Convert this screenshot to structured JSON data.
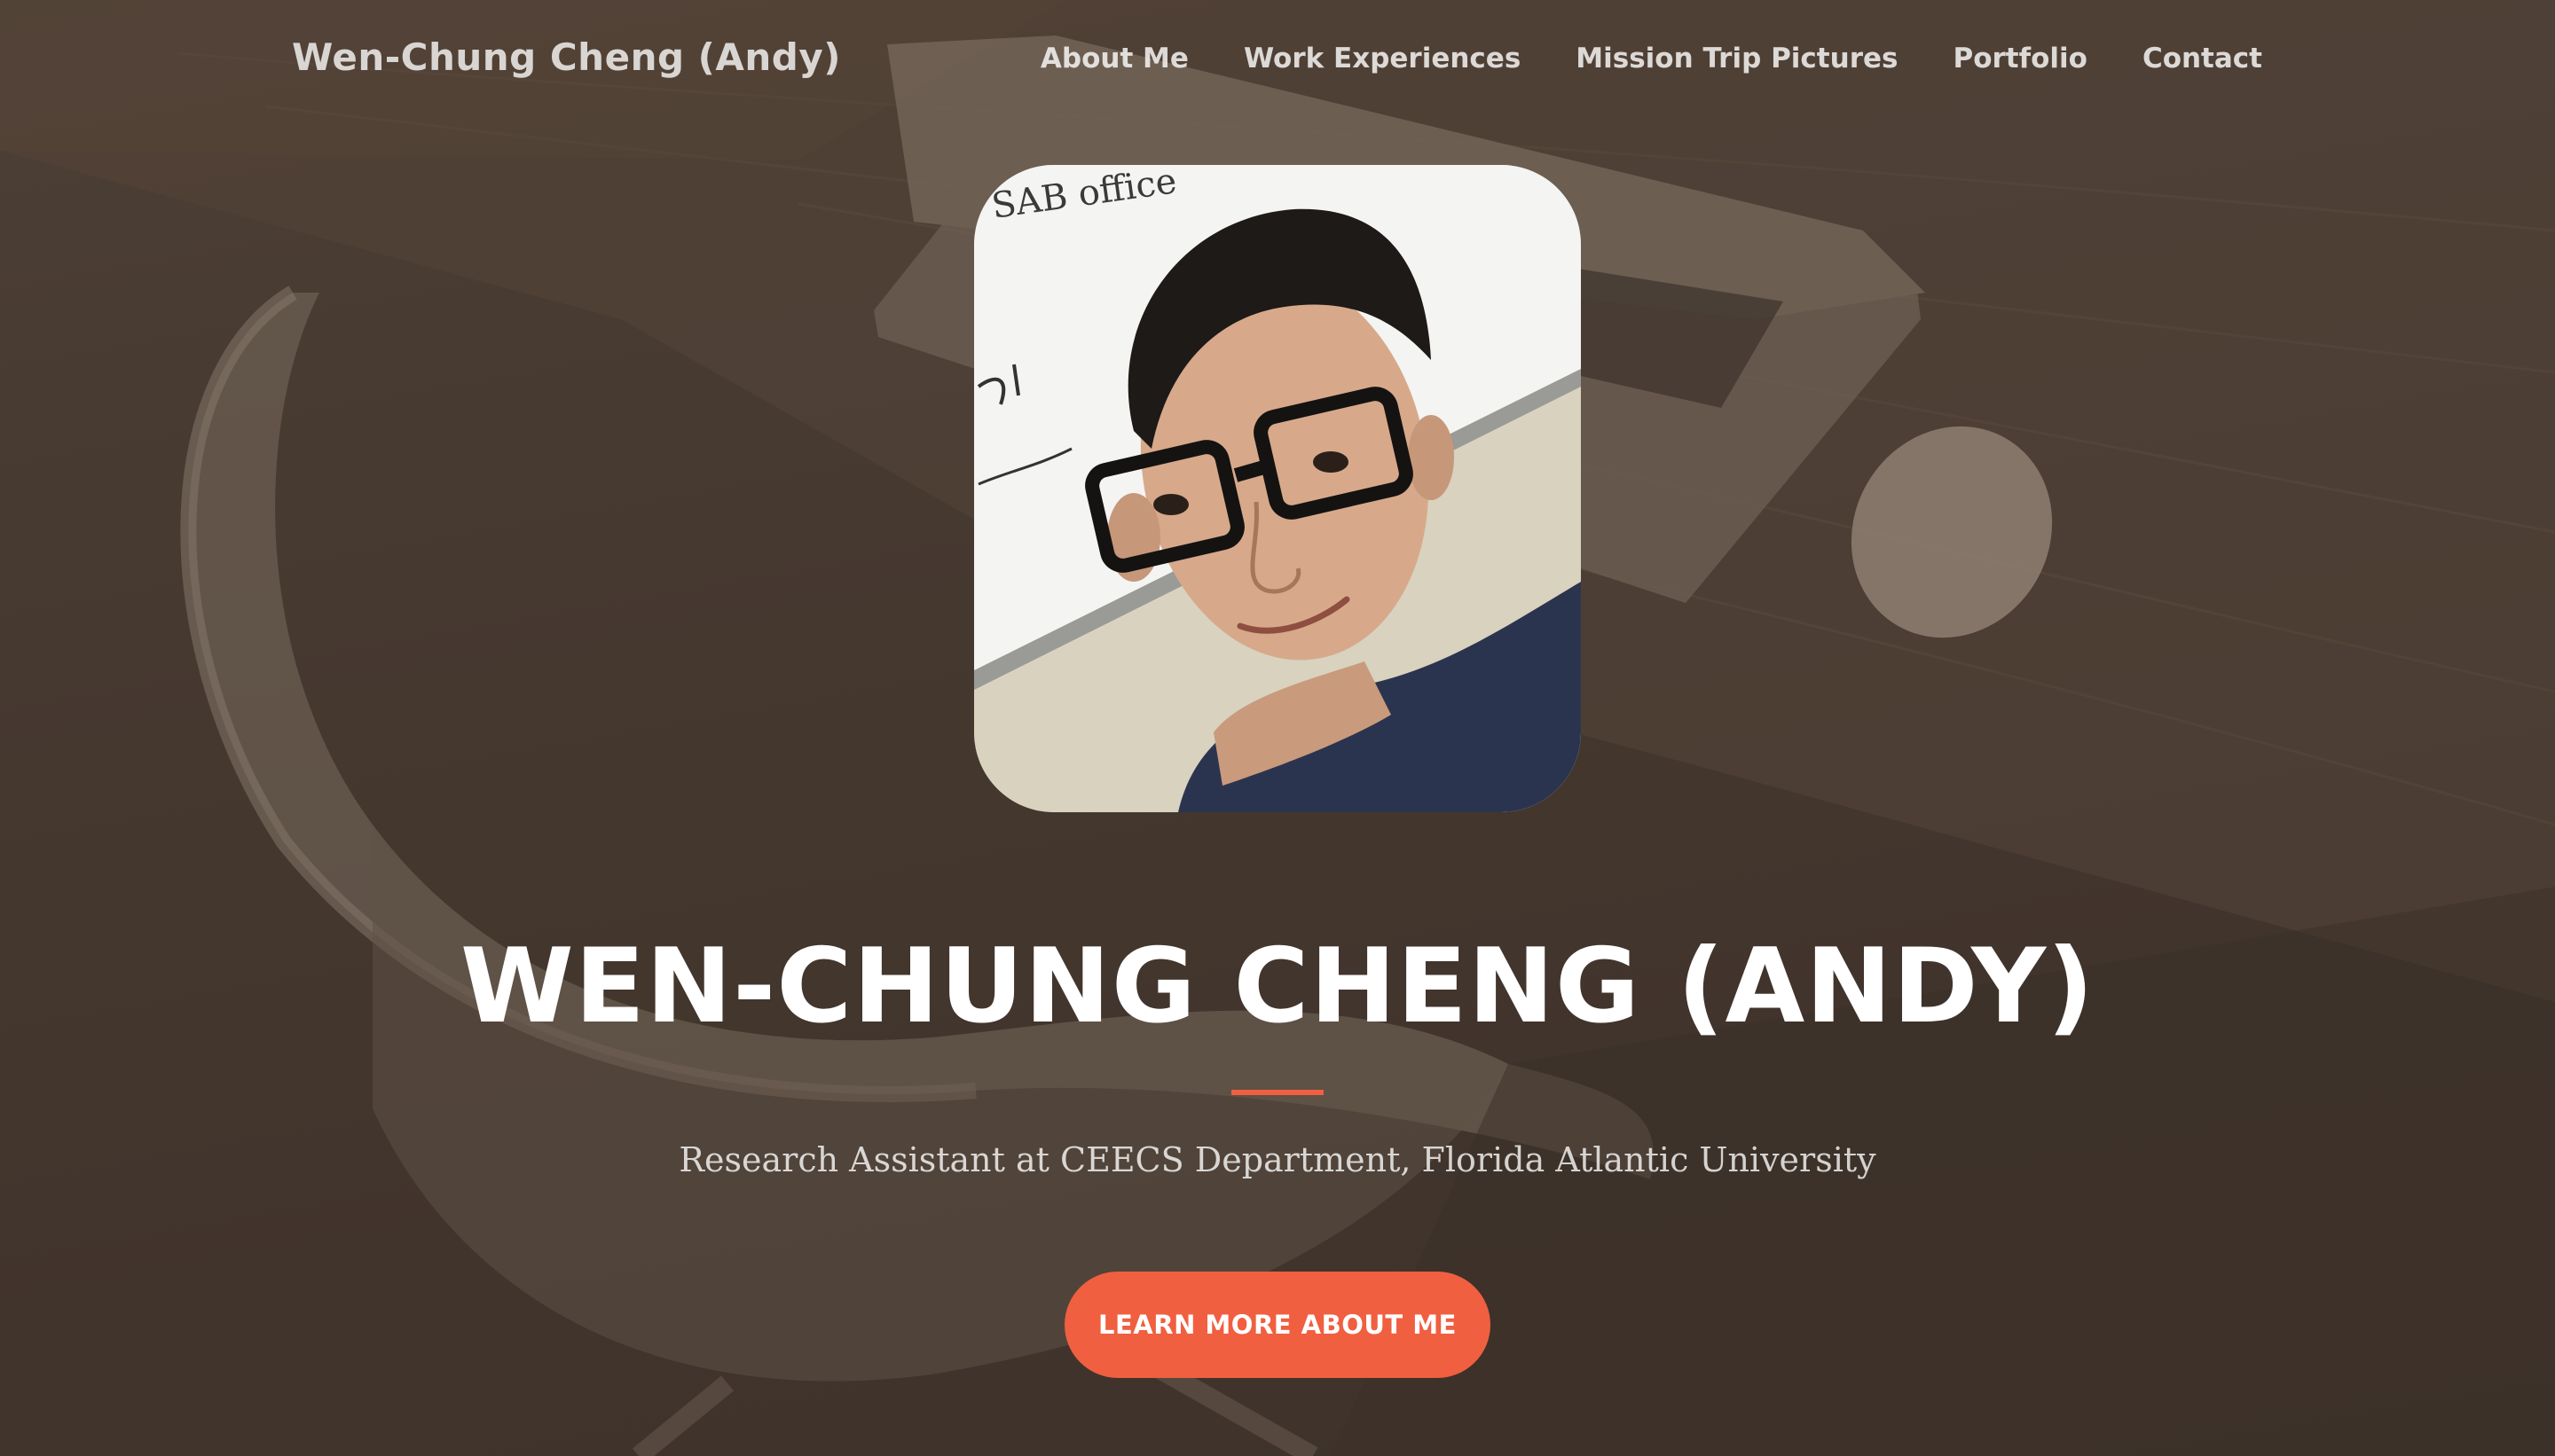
{
  "navbar": {
    "brand": "Wen-Chung Cheng (Andy)",
    "links": [
      {
        "label": "About Me"
      },
      {
        "label": "Work Experiences"
      },
      {
        "label": "Mission Trip Pictures"
      },
      {
        "label": "Portfolio"
      },
      {
        "label": "Contact"
      }
    ]
  },
  "hero": {
    "photo_icon": "profile-photo",
    "photo_whiteboard_text": "SAB office",
    "title": "WEN-CHUNG CHENG (ANDY)",
    "subtitle": "Research Assistant at CEECS Department, Florida Atlantic University",
    "cta_label": "LEARN MORE ABOUT ME"
  },
  "colors": {
    "accent": "#f05f40",
    "background": "#4a3d33",
    "text": "#ffffff"
  }
}
